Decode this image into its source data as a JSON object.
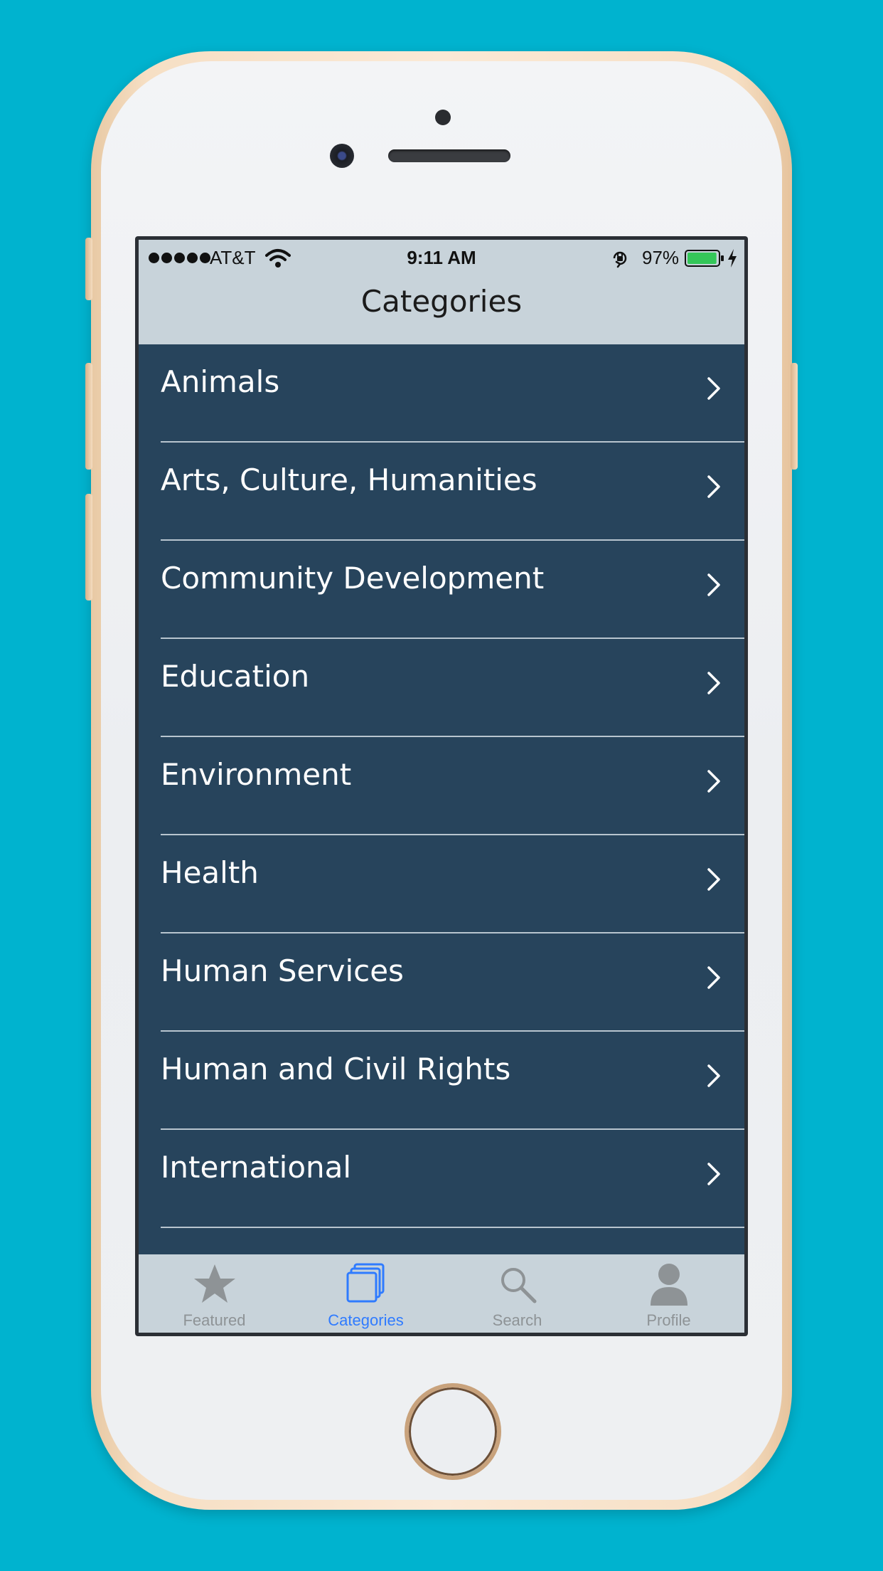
{
  "status_bar": {
    "carrier": "AT&T",
    "time": "9:11 AM",
    "battery_percent": "97%",
    "battery_level": 0.97,
    "signal_bars": 5,
    "icons": [
      "wifi-icon",
      "orientation-lock-icon",
      "battery-icon",
      "charging-bolt-icon"
    ]
  },
  "nav": {
    "title": "Categories"
  },
  "categories": {
    "items": [
      {
        "label": "Animals"
      },
      {
        "label": "Arts, Culture, Humanities"
      },
      {
        "label": "Community Development"
      },
      {
        "label": "Education"
      },
      {
        "label": "Environment"
      },
      {
        "label": "Health"
      },
      {
        "label": "Human Services"
      },
      {
        "label": "Human and Civil Rights"
      },
      {
        "label": "International"
      }
    ],
    "row_icon": "chevron-right-icon"
  },
  "tab_bar": {
    "tabs": [
      {
        "label": "Featured",
        "icon": "star-icon",
        "active": false
      },
      {
        "label": "Categories",
        "icon": "categories-stack-icon",
        "active": true
      },
      {
        "label": "Search",
        "icon": "search-icon",
        "active": false
      },
      {
        "label": "Profile",
        "icon": "profile-icon",
        "active": false
      }
    ]
  },
  "colors": {
    "background": "#00b3cf",
    "list_background": "#27445c",
    "bar_background": "#c8d3da",
    "active_tab": "#2f7bff",
    "inactive_tab": "#8e9396",
    "battery_fill": "#34c759"
  }
}
